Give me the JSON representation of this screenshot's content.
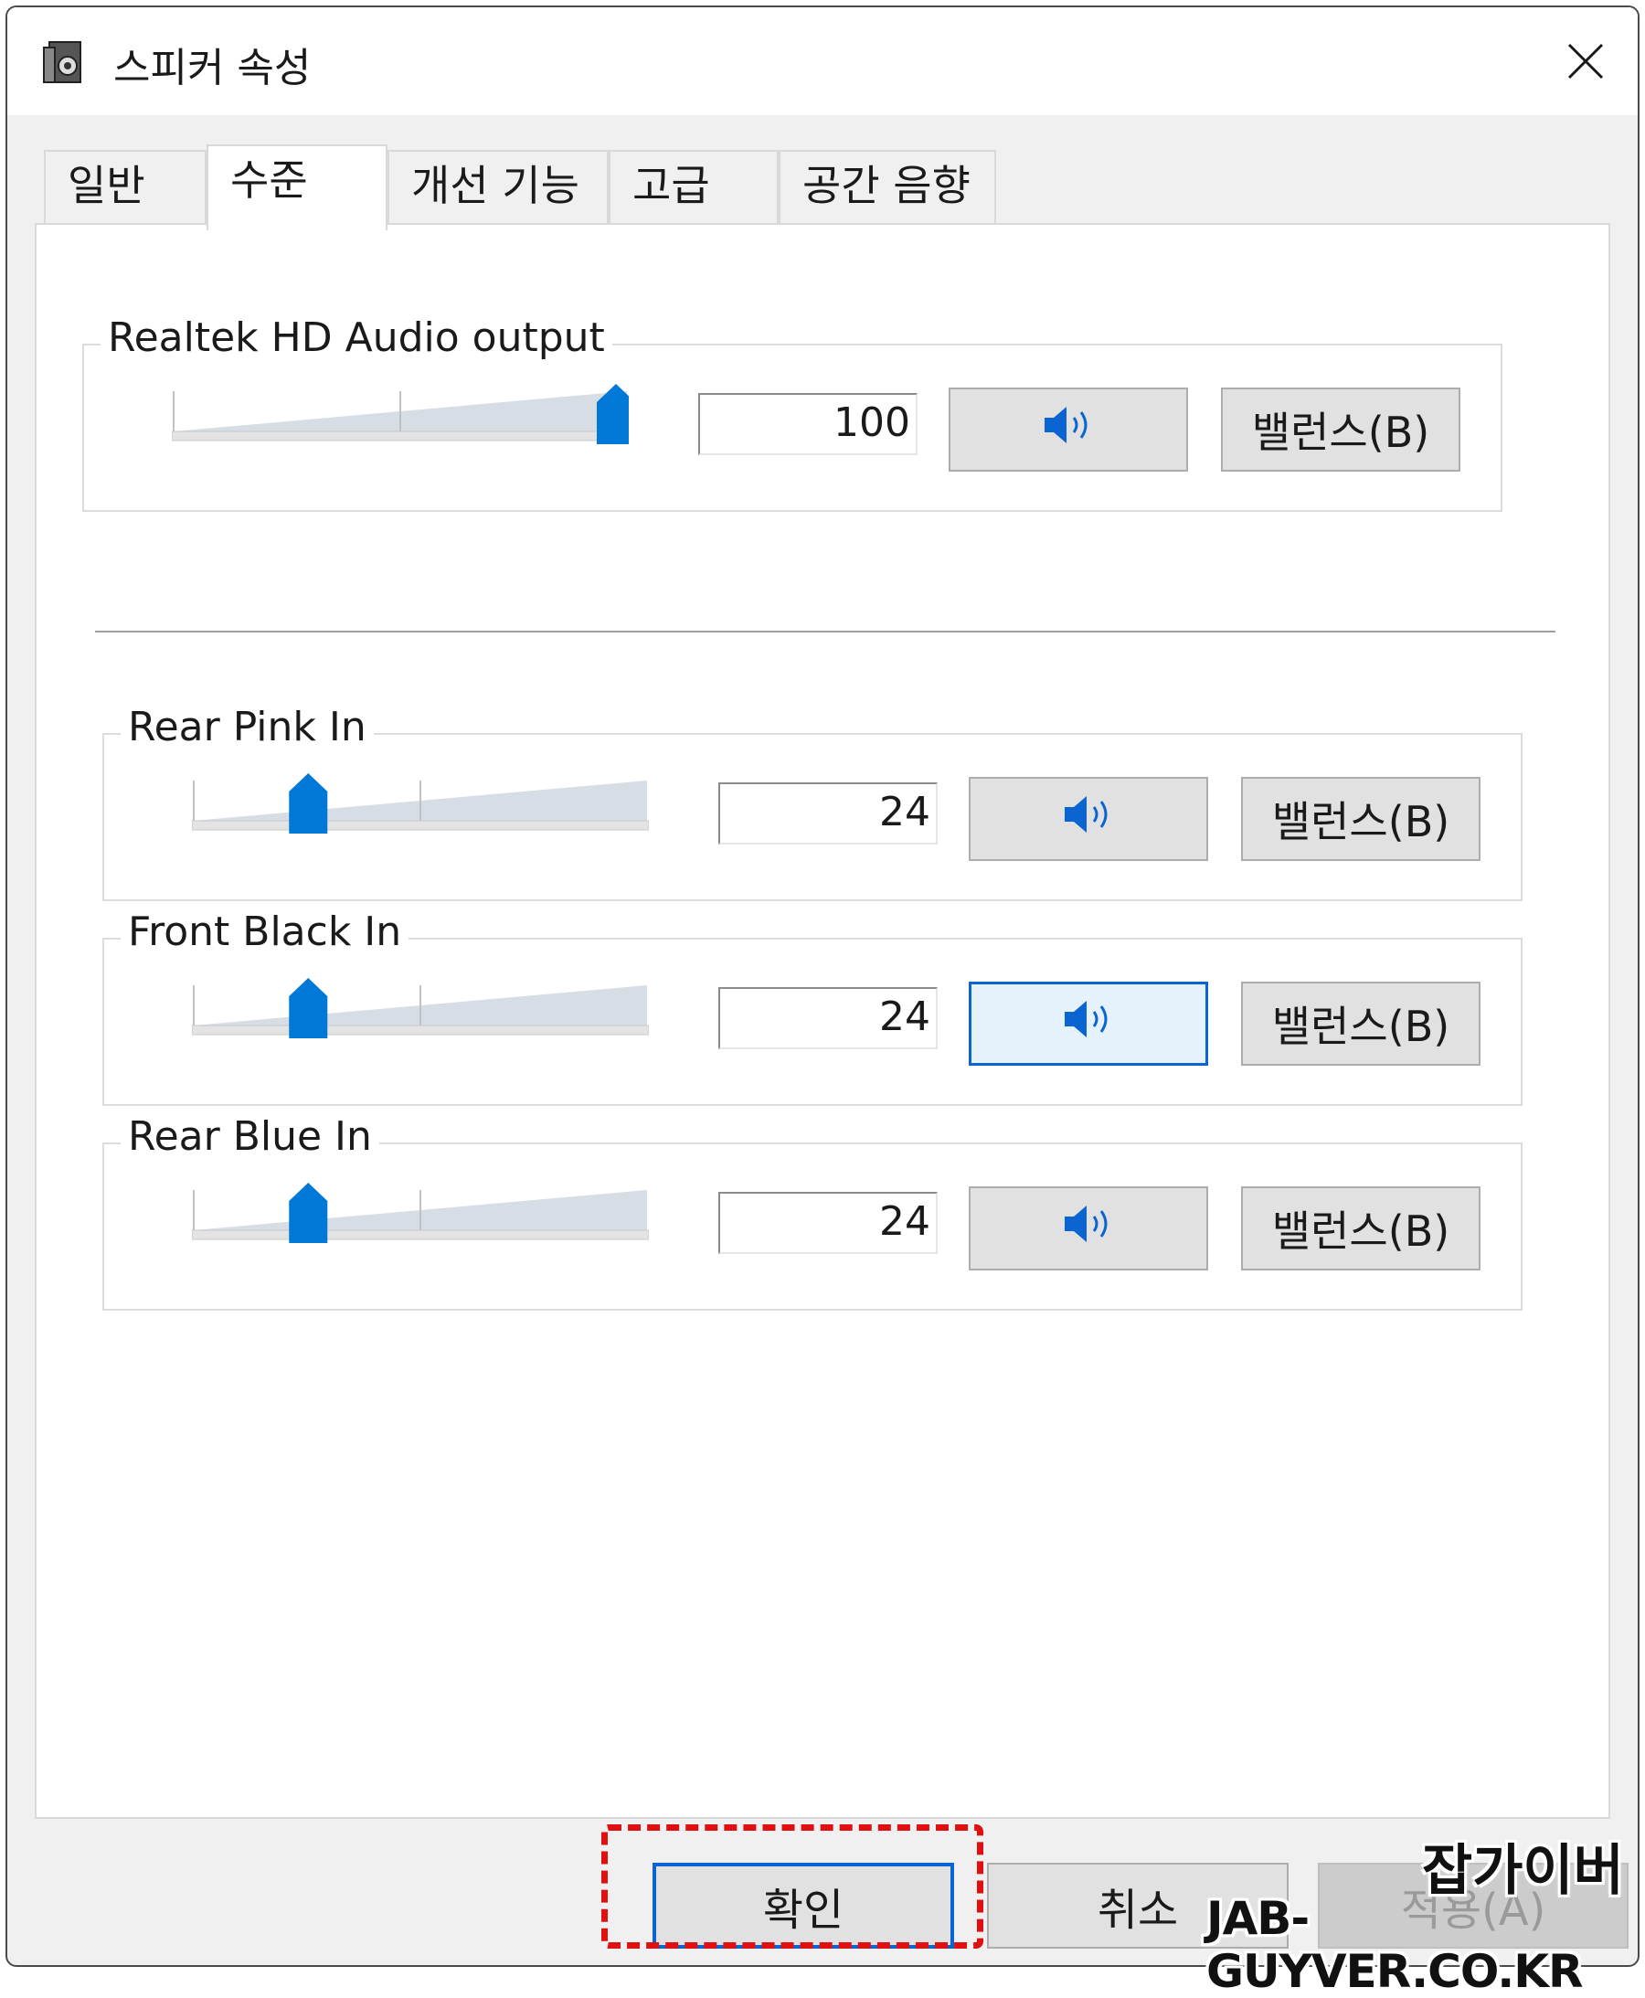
{
  "window": {
    "title": "스피커 속성"
  },
  "tabs": [
    {
      "label": "일반"
    },
    {
      "label": "수준"
    },
    {
      "label": "개선 기능"
    },
    {
      "label": "고급"
    },
    {
      "label": "공간 음향"
    }
  ],
  "active_tab": "수준",
  "devices": [
    {
      "name": "Realtek HD Audio output",
      "volume": "100",
      "volume_fraction": 1.0,
      "balance_label": "밸런스(B)"
    },
    {
      "name": "Rear Pink In",
      "volume": "24",
      "volume_fraction": 0.24,
      "balance_label": "밸런스(B)"
    },
    {
      "name": "Front Black In",
      "volume": "24",
      "volume_fraction": 0.24,
      "balance_label": "밸런스(B)"
    },
    {
      "name": "Rear Blue In",
      "volume": "24",
      "volume_fraction": 0.24,
      "balance_label": "밸런스(B)"
    }
  ],
  "footer": {
    "ok_label": "확인",
    "cancel_label": "취소",
    "apply_label": "적용(A)"
  },
  "watermark": {
    "line1": "잡가이버",
    "line2": "JAB-GUYVER.CO.KR"
  },
  "colors": {
    "accent": "#0a64d2",
    "thumb": "#0078d7",
    "highlight": "#e01010"
  },
  "icons": {
    "app": "speaker-properties-icon",
    "close": "close-icon",
    "mute": "speaker-volume-icon"
  }
}
